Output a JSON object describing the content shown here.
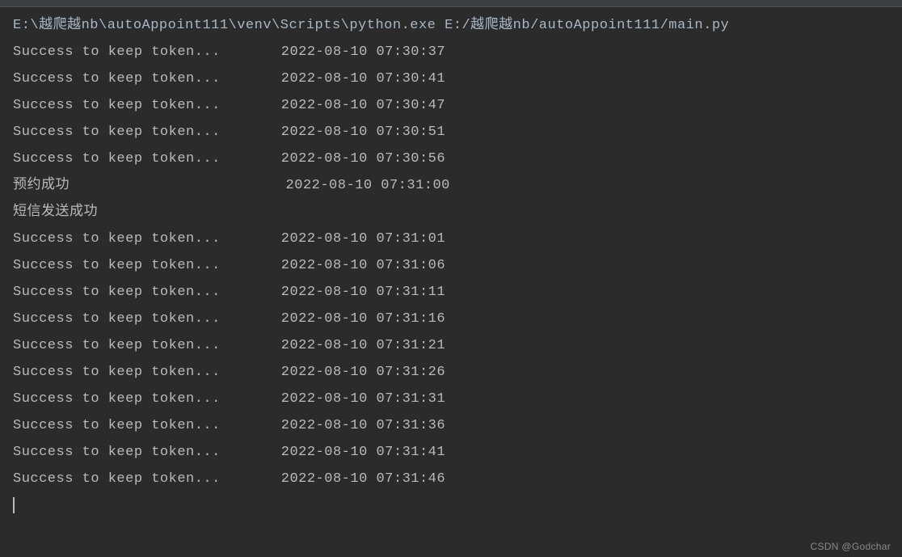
{
  "command": "E:\\越爬越nb\\autoAppoint111\\venv\\Scripts\\python.exe E:/越爬越nb/autoAppoint111/main.py",
  "lines": [
    {
      "text": "Success to keep token...       2022-08-10 07:30:37"
    },
    {
      "text": "Success to keep token...       2022-08-10 07:30:41"
    },
    {
      "text": "Success to keep token...       2022-08-10 07:30:47"
    },
    {
      "text": "Success to keep token...       2022-08-10 07:30:51"
    },
    {
      "text": "Success to keep token...       2022-08-10 07:30:56"
    },
    {
      "text": "预约成功                         2022-08-10 07:31:00"
    },
    {
      "text": "短信发送成功"
    },
    {
      "text": "Success to keep token...       2022-08-10 07:31:01"
    },
    {
      "text": "Success to keep token...       2022-08-10 07:31:06"
    },
    {
      "text": "Success to keep token...       2022-08-10 07:31:11"
    },
    {
      "text": "Success to keep token...       2022-08-10 07:31:16"
    },
    {
      "text": "Success to keep token...       2022-08-10 07:31:21"
    },
    {
      "text": "Success to keep token...       2022-08-10 07:31:26"
    },
    {
      "text": "Success to keep token...       2022-08-10 07:31:31"
    },
    {
      "text": "Success to keep token...       2022-08-10 07:31:36"
    },
    {
      "text": "Success to keep token...       2022-08-10 07:31:41"
    },
    {
      "text": "Success to keep token...       2022-08-10 07:31:46"
    }
  ],
  "watermark": "CSDN @Godchar"
}
